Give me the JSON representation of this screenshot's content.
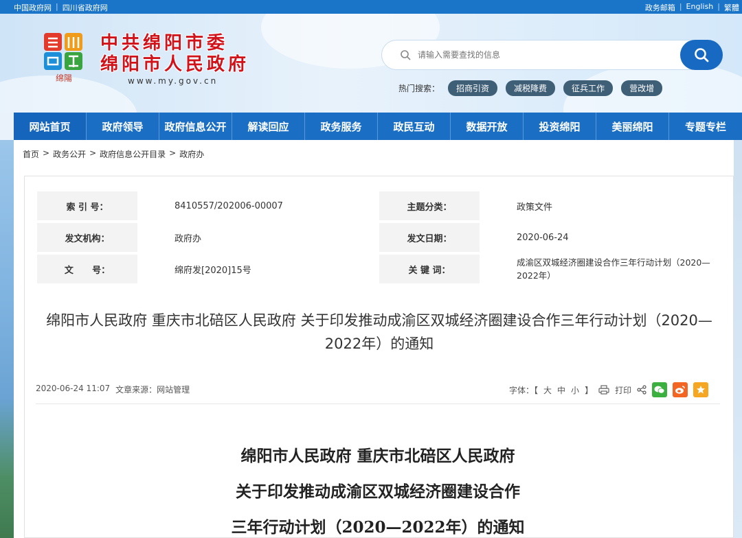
{
  "topbar": {
    "left_links": [
      "中国政府网",
      "四川省政府网"
    ],
    "right_links": [
      "政务邮箱",
      "English",
      "繁體"
    ]
  },
  "site": {
    "name_line1": "中共绵阳市委",
    "name_line2": "绵阳市人民政府",
    "url": "www.my.gov.cn",
    "logo_caption": "绵陽"
  },
  "search": {
    "placeholder": "请输入需要查找的信息",
    "hot_label": "热门搜索：",
    "hot_tags": [
      "招商引资",
      "减税降费",
      "征兵工作",
      "营改增"
    ]
  },
  "nav": {
    "items": [
      "网站首页",
      "政府领导",
      "政府信息公开",
      "解读回应",
      "政务服务",
      "政民互动",
      "数据开放",
      "投资绵阳",
      "美丽绵阳",
      "专题专栏"
    ]
  },
  "breadcrumb": [
    "首页",
    "政务公开",
    "政府信息公开目录",
    "政府办"
  ],
  "breadcrumb_sep": ">",
  "meta": {
    "index_label": "索 引 号：",
    "index_value": "8410557/202006-00007",
    "topic_label": "主题分类：",
    "topic_value": "政策文件",
    "org_label": "发文机构：",
    "org_value": "政府办",
    "date_label": "发文日期：",
    "date_value": "2020-06-24",
    "docno_label": "文      号：",
    "docno_value": "绵府发[2020]15号",
    "keywords_label": "关 键 词：",
    "keywords_value": "成渝区双城经济圈建设合作三年行动计划（2020—2022年）"
  },
  "article": {
    "headline": "绵阳市人民政府  重庆市北碚区人民政府 关于印发推动成渝区双城经济圈建设合作三年行动计划（2020—2022年）的通知",
    "datetime": "2020-06-24 11:07",
    "source_label": "文章来源：",
    "source_value": "网站管理",
    "font_label": "字体：【",
    "font_big": "大",
    "font_mid": "中",
    "font_small": "小",
    "font_end": "】",
    "print_label": "打印",
    "title_line1": "绵阳市人民政府  重庆市北碚区人民政府",
    "title_line2": "关于印发推动成渝区双城经济圈建设合作",
    "title_line3": "三年行动计划（2020—2022年）的通知"
  },
  "colors": {
    "primary_blue": "#1a6fc4",
    "brand_red": "#d0121a",
    "wechat_green": "#3bb03e",
    "weibo_orange": "#f26522",
    "fav_orange": "#f5a623"
  }
}
